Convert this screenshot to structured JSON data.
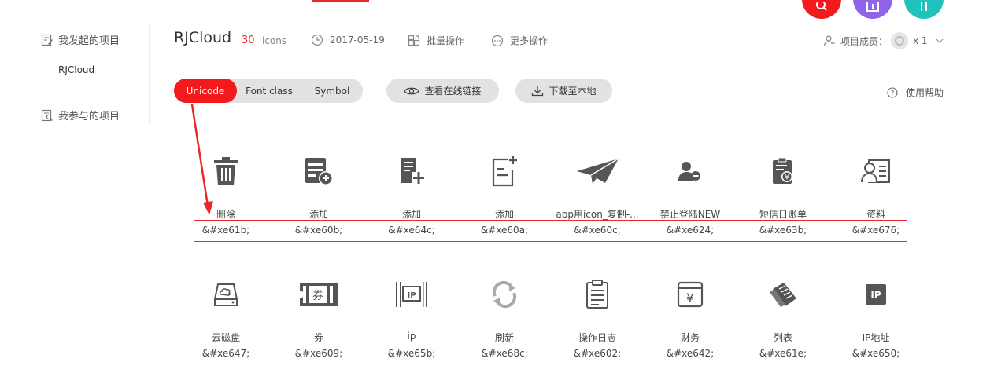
{
  "sidebar": {
    "my_projects_label": "我发起的项目",
    "project_item": "RJCloud",
    "joined_projects_label": "我参与的项目"
  },
  "header": {
    "project_name": "RJCloud",
    "icon_count": "30",
    "icon_count_unit": "icons",
    "date": "2017-05-19",
    "batch_label": "批量操作",
    "more_label": "更多操作",
    "members_label": "项目成员：",
    "members_count": "x 1"
  },
  "tabs": [
    {
      "label": "Unicode",
      "active": true
    },
    {
      "label": "Font class",
      "active": false
    },
    {
      "label": "Symbol",
      "active": false
    }
  ],
  "actions": {
    "view_online": "查看在线链接",
    "download": "下载至本地",
    "help": "使用帮助"
  },
  "icons_row1": [
    {
      "name": "删除",
      "code": "&#xe61b;",
      "icon": "trash-icon"
    },
    {
      "name": "添加",
      "code": "&#xe60b;",
      "icon": "list-add-icon"
    },
    {
      "name": "添加",
      "code": "&#xe64c;",
      "icon": "doc-add-icon"
    },
    {
      "name": "添加",
      "code": "&#xe60a;",
      "icon": "file-add-icon"
    },
    {
      "name": "app用icon_复制-...",
      "code": "&#xe60c;",
      "icon": "paper-plane-icon"
    },
    {
      "name": "禁止登陆NEW",
      "code": "&#xe624;",
      "icon": "user-forbid-icon"
    },
    {
      "name": "短信日账单",
      "code": "&#xe63b;",
      "icon": "bill-icon"
    },
    {
      "name": "资料",
      "code": "&#xe676;",
      "icon": "profile-card-icon"
    }
  ],
  "icons_row2": [
    {
      "name": "云磁盘",
      "code": "&#xe647;",
      "icon": "cloud-disk-icon"
    },
    {
      "name": "券",
      "code": "&#xe609;",
      "icon": "coupon-icon"
    },
    {
      "name": "ip",
      "code": "&#xe65b;",
      "icon": "ip-barcode-icon"
    },
    {
      "name": "刷新",
      "code": "&#xe68c;",
      "icon": "refresh-icon"
    },
    {
      "name": "操作日志",
      "code": "&#xe602;",
      "icon": "clipboard-log-icon"
    },
    {
      "name": "财务",
      "code": "&#xe642;",
      "icon": "finance-icon"
    },
    {
      "name": "列表",
      "code": "&#xe61e;",
      "icon": "list-sheet-icon"
    },
    {
      "name": "IP地址",
      "code": "&#xe650;",
      "icon": "ip-address-icon"
    }
  ],
  "colors": {
    "accent": "#f4191c",
    "highlight_border": "#e8282b",
    "icon_gray": "#555555",
    "pill_bg": "#e2e2e2"
  }
}
